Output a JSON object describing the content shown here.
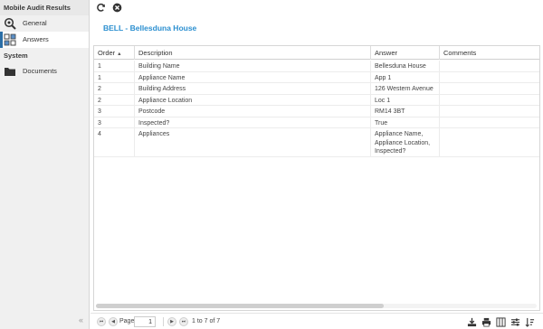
{
  "sidebar": {
    "section1_title": "Mobile Audit Results",
    "items": [
      {
        "label": "General",
        "icon": "magnifier-icon"
      },
      {
        "label": "Answers",
        "icon": "answers-icon"
      }
    ],
    "section2_title": "System",
    "items2": [
      {
        "label": "Documents",
        "icon": "folder-icon"
      }
    ],
    "collapse_glyph": "«"
  },
  "toolbar": {
    "refresh_icon": "refresh-icon",
    "close_icon": "close-icon"
  },
  "record": {
    "title": "BELL - Bellesduna House"
  },
  "grid": {
    "columns": [
      "Order",
      "Description",
      "Answer",
      "Comments"
    ],
    "sort_indicator": "▲",
    "rows": [
      {
        "order": "1",
        "description": "Building Name",
        "answer": "Bellesduna House",
        "comments": ""
      },
      {
        "order": "1",
        "description": "Appliance Name",
        "answer": "App 1",
        "comments": ""
      },
      {
        "order": "2",
        "description": "Building Address",
        "answer": "126 Western Avenue",
        "comments": ""
      },
      {
        "order": "2",
        "description": "Appliance Location",
        "answer": "Loc 1",
        "comments": ""
      },
      {
        "order": "3",
        "description": "Postcode",
        "answer": "RM14 3BT",
        "comments": ""
      },
      {
        "order": "3",
        "description": "Inspected?",
        "answer": "True",
        "comments": ""
      },
      {
        "order": "4",
        "description": "Appliances",
        "answer": "Appliance Name, Appliance Location, Inspected?",
        "comments": ""
      }
    ]
  },
  "pager": {
    "page_label": "Page",
    "page_value": "1",
    "summary": "1 to 7 of 7"
  },
  "colors": {
    "accent": "#2b8fd0",
    "active_bar": "#2b6ea6"
  }
}
